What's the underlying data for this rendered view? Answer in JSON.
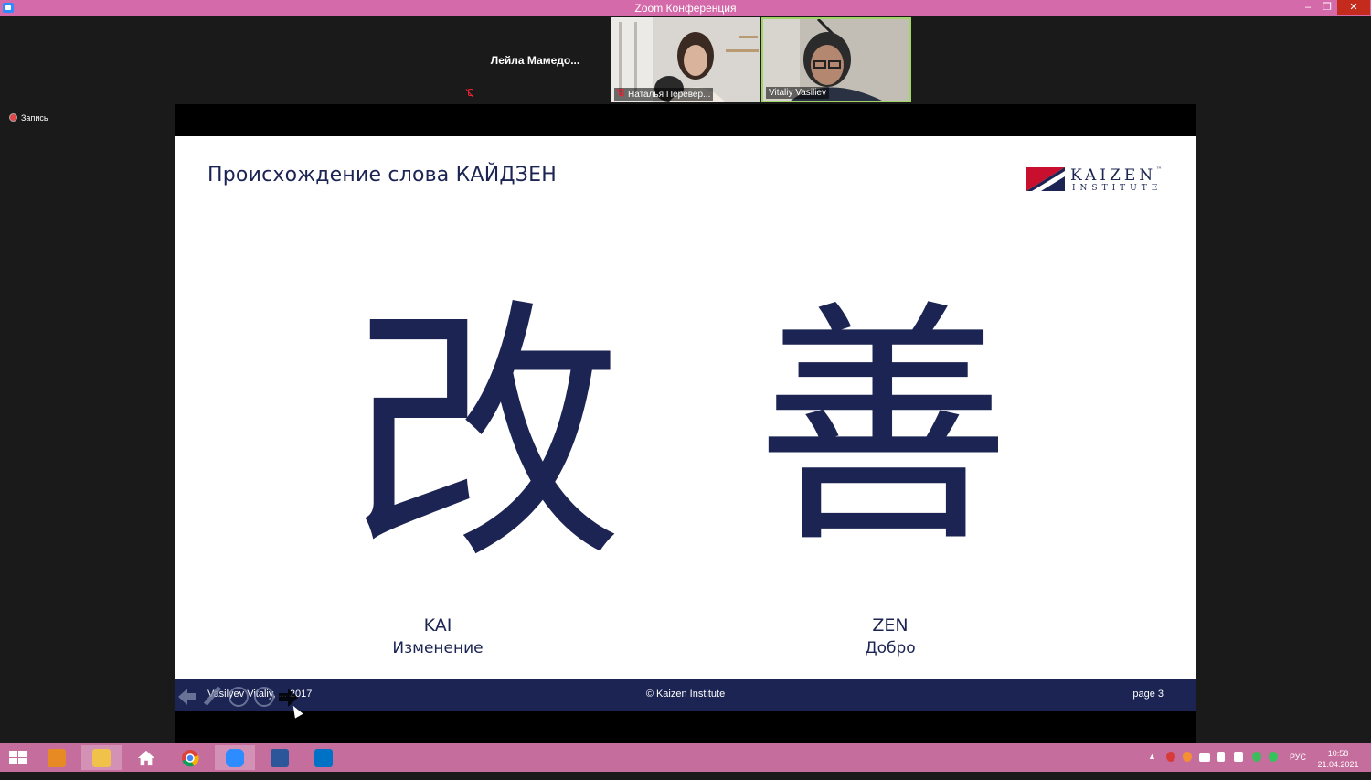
{
  "window": {
    "title": "Zoom Конференция",
    "minimize": "–",
    "maximize": "❐",
    "close": "✕"
  },
  "participants": [
    {
      "name": "Лейла Мамедо...",
      "label": "",
      "muted": true
    },
    {
      "name": "",
      "label": "Наталья Перевер...",
      "muted": true
    },
    {
      "name": "",
      "label": "Vitaliy Vasiliev",
      "muted": false
    }
  ],
  "recording": {
    "label": "Запись"
  },
  "slide": {
    "title": "Происхождение слова КАЙДЗЕН",
    "logo": {
      "word": "KAIZEN",
      "tm": "™",
      "sub": "INSTITUTE"
    },
    "kanji": [
      {
        "glyph": "改",
        "romaji": "KAI",
        "meaning": "Изменение"
      },
      {
        "glyph": "善",
        "romaji": "ZEN",
        "meaning": "Добро"
      }
    ],
    "footer": {
      "left": "Vasilyev Vitaliy, ... 2017",
      "center": "© Kaizen Institute",
      "right": "page 3"
    }
  },
  "taskbar": {
    "apps": [
      "start",
      "media-player",
      "file-explorer",
      "home",
      "chrome",
      "zoom",
      "word",
      "outlook"
    ],
    "language": "РУС",
    "time": "10:58",
    "date": "21.04.2021"
  },
  "colors": {
    "titlebar": "#d46aa9",
    "taskbar": "#c56e9d",
    "navy": "#1b2452",
    "logo_red": "#c8102e"
  }
}
